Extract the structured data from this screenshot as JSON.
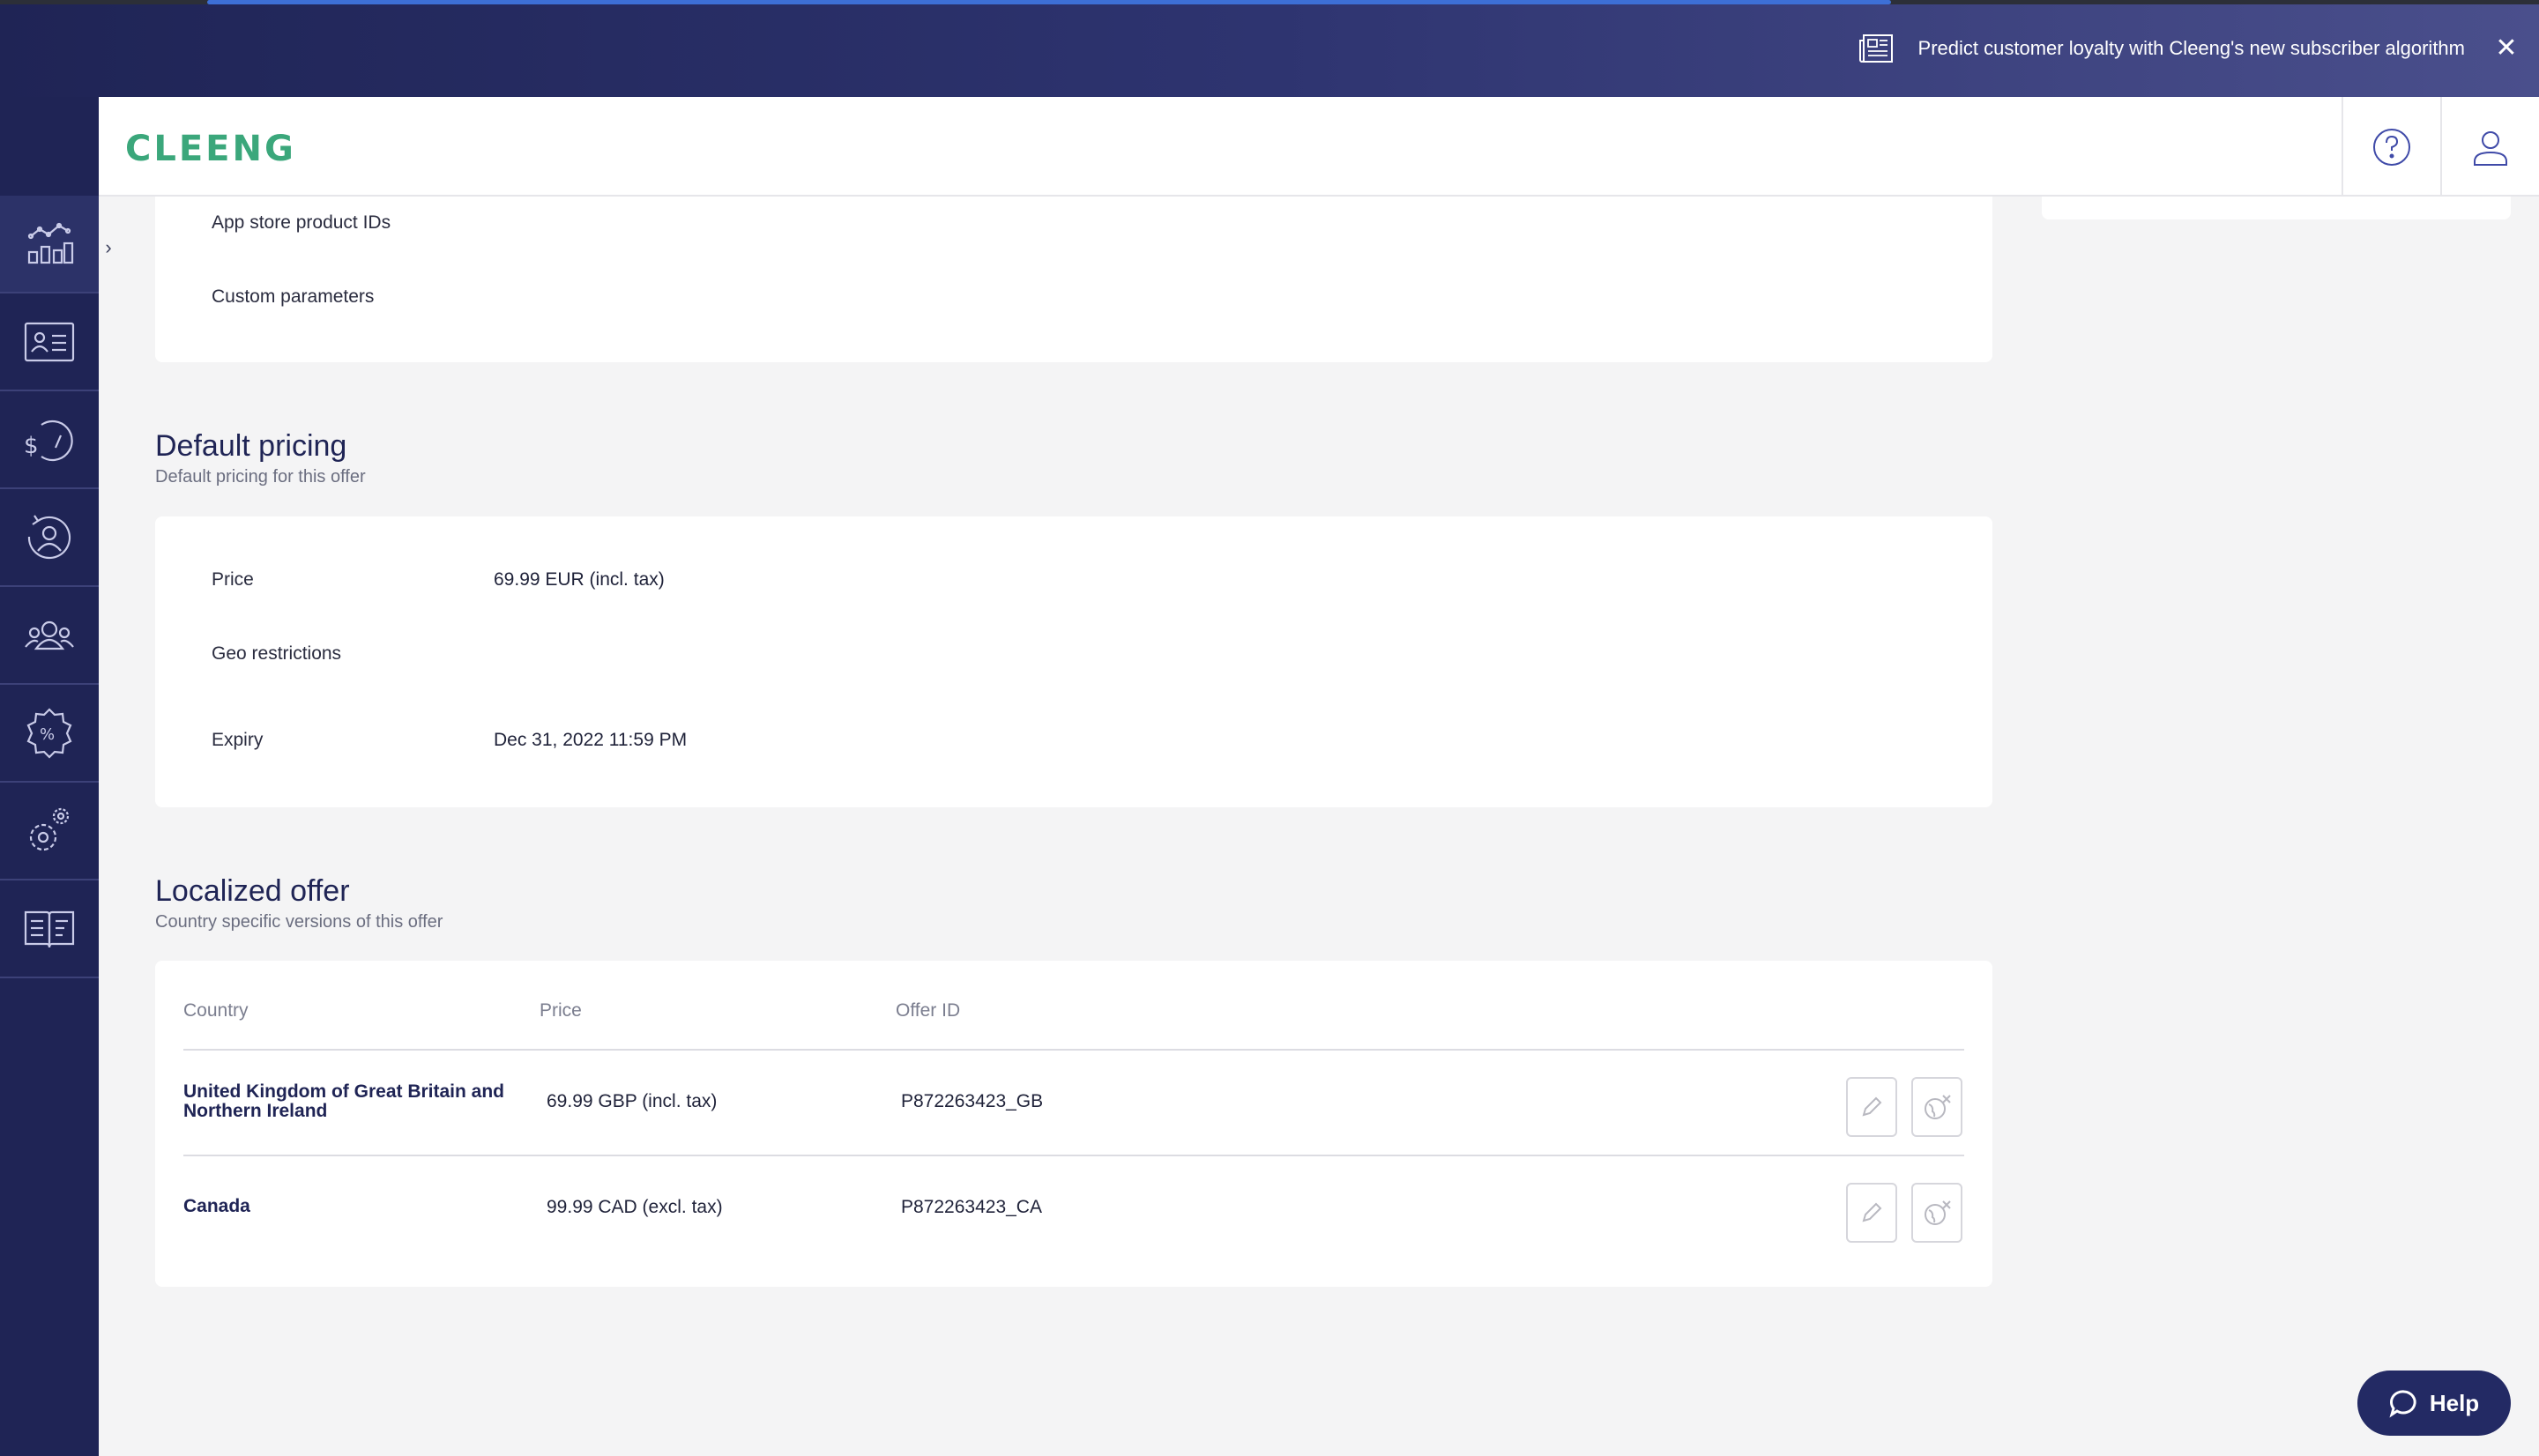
{
  "banner": {
    "message": "Predict customer loyalty with Cleeng's new subscriber algorithm",
    "close_label": "✕"
  },
  "header": {
    "logo_text": "CLEENG"
  },
  "sidebar": {
    "toggle_label": "›",
    "items": [
      {
        "name": "analytics",
        "icon": "analytics-chart-icon"
      },
      {
        "name": "customers",
        "icon": "customer-card-icon"
      },
      {
        "name": "revenue",
        "icon": "revenue-gauge-icon"
      },
      {
        "name": "retention",
        "icon": "user-refresh-icon"
      },
      {
        "name": "users",
        "icon": "users-group-icon"
      },
      {
        "name": "offers",
        "icon": "discount-badge-icon"
      },
      {
        "name": "settings",
        "icon": "settings-gears-icon"
      },
      {
        "name": "docs",
        "icon": "book-icon"
      }
    ]
  },
  "offer_details": {
    "app_store_label": "App store product IDs",
    "custom_params_label": "Custom parameters"
  },
  "default_pricing": {
    "title": "Default pricing",
    "subtitle": "Default pricing for this offer",
    "price_label": "Price",
    "price_value": "69.99 EUR (incl. tax)",
    "geo_label": "Geo restrictions",
    "expiry_label": "Expiry",
    "expiry_value": "Dec 31, 2022 11:59 PM"
  },
  "localized_offer": {
    "title": "Localized offer",
    "subtitle": "Country specific versions of this offer",
    "columns": [
      "Country",
      "Price",
      "Offer ID"
    ],
    "rows": [
      {
        "country": "United Kingdom of Great Britain and Northern Ireland",
        "price": "69.99 GBP (incl. tax)",
        "offer_id": "P872263423_GB"
      },
      {
        "country": "Canada",
        "price": "99.99 CAD (excl. tax)",
        "offer_id": "P872263423_CA"
      }
    ]
  },
  "help": {
    "label": "Help"
  },
  "colors": {
    "brand_navy": "#1f2455",
    "logo_green": "#3ba77b",
    "help_button": "#232a64"
  }
}
